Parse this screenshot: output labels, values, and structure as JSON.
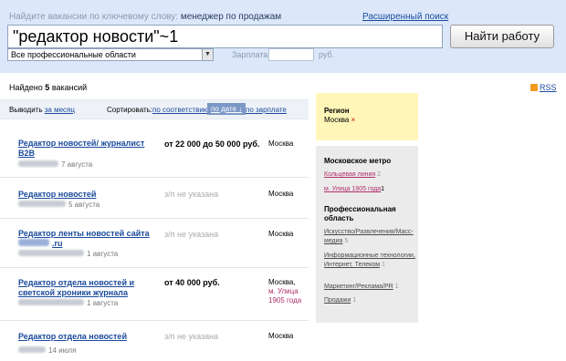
{
  "header": {
    "hint_prefix": "Найдите вакансии по ключевому слову:",
    "hint_example": "менеджер по продажам",
    "advanced_search": "Расширенный поиск",
    "search_value": "\"редактор новости\"~1",
    "find_button": "Найти работу",
    "area_select": "Все профессиональные области",
    "salary_label": "Зарплата:",
    "salary_value": "",
    "salary_unit": "руб."
  },
  "results": {
    "found_prefix": "Найдено",
    "found_count": "5",
    "found_suffix": "вакансий",
    "rss": "RSS"
  },
  "sortbar": {
    "show_label": "Выводить",
    "period": "за месяц",
    "sort_label": "Сортировать:",
    "by_relevance": "по соответствию",
    "by_date": "по дате ↓",
    "by_salary": "по зарплате"
  },
  "jobs": [
    {
      "title": "Редактор новостей/ журналист B2B",
      "date": "7 августа",
      "salary": "от 22 000 до 50 000 руб.",
      "city": "Москва"
    },
    {
      "title": "Редактор новостей",
      "date": "5 августа",
      "salary": "з/п не указана",
      "city": "Москва"
    },
    {
      "title": "Редактор ленты новостей сайта",
      "site_suffix": ".ru",
      "date": "1 августа",
      "salary": "з/п не указана",
      "city": "Москва"
    },
    {
      "title": "Редактор отдела новостей и светской хроники журнала",
      "date": "1 августа",
      "salary": "от 40 000 руб.",
      "city": "Москва,",
      "metro": "м. Улица 1905 года"
    },
    {
      "title": "Редактор отдела новостей",
      "date": "14 июля",
      "salary": "з/п не указана",
      "city": "Москва"
    }
  ],
  "sidebar": {
    "region_title": "Регион",
    "region_value": "Москва",
    "region_remove": "×",
    "metro_title": "Московское метро",
    "metro_items": [
      {
        "label": "Кольцевая линия",
        "count": "2"
      },
      {
        "label": "м. Улица 1905 года",
        "count": "1"
      }
    ],
    "area_title": "Профессиональная область",
    "area_items": [
      {
        "label": "Искусство/Развлечения/Масс-медиа",
        "count": "5"
      },
      {
        "label": "Информационные технологии, Интернет, Телеком",
        "count": "1"
      },
      {
        "label": "Маркетинг/Реклама/PR",
        "count": "1"
      },
      {
        "label": "Продажи",
        "count": "1"
      }
    ]
  },
  "colors": {
    "header_bg": "#dce8fa",
    "link": "#1a4a9c",
    "region_bg": "#fff6b8",
    "sidebar_bg": "#ebebeb",
    "metro": "#b0306a"
  }
}
